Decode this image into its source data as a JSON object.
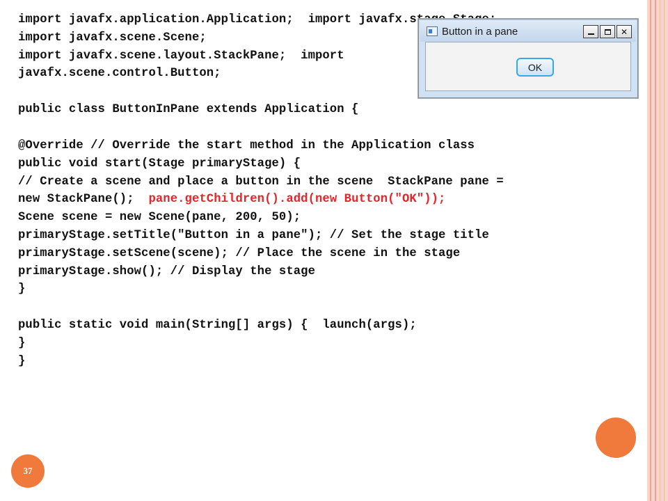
{
  "code_lines": [
    "import javafx.application.Application;  import javafx.stage.Stage;",
    "import javafx.scene.Scene;",
    "import javafx.scene.layout.StackPane;  import",
    "javafx.scene.control.Button;",
    "public class ButtonInPane extends Application {",
    "@Override // Override the start method in the Application class",
    "public void start(Stage primaryStage) {",
    "// Create a scene and place a button in the scene  StackPane pane =",
    "new StackPane();  ",
    "pane.getChildren().add(new Button(\"OK\"));",
    "Scene scene = new Scene(pane, 200, 50);",
    "primaryStage.setTitle(\"Button in a pane\"); // Set the stage title",
    "primaryStage.setScene(scene); // Place the scene in the stage",
    "primaryStage.show(); // Display the stage",
    "}",
    "public static void main(String[] args) {  launch(args);",
    "}",
    "}"
  ],
  "window": {
    "title": "Button in a pane",
    "button_label": "OK",
    "controls": [
      "minimize",
      "maximize",
      "close"
    ]
  },
  "slide_number": "37",
  "colors": {
    "highlight": "#e8242b",
    "accent": "#f07a3c"
  }
}
